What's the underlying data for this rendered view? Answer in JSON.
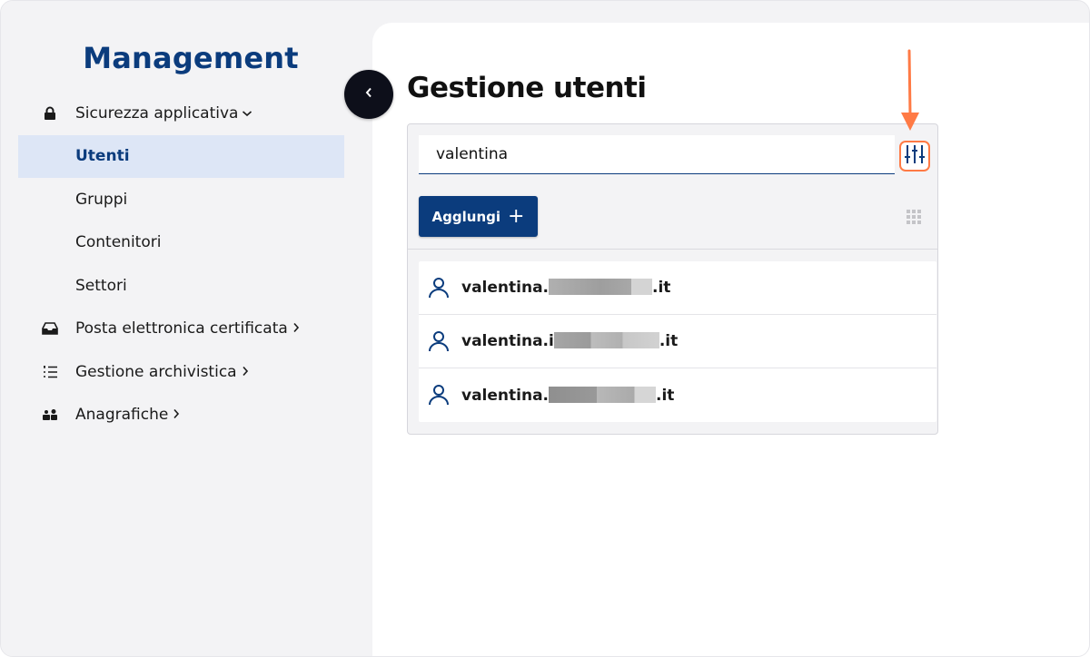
{
  "sidebar": {
    "brand": "Management",
    "items": [
      {
        "label": "Sicurezza applicativa",
        "icon": "lock-icon",
        "chevron": "down"
      },
      {
        "label": "Utenti",
        "active": true
      },
      {
        "label": "Gruppi"
      },
      {
        "label": "Contenitori"
      },
      {
        "label": "Settori"
      },
      {
        "label": "Posta elettronica certificata",
        "icon": "inbox-icon",
        "chevron": "right"
      },
      {
        "label": "Gestione archivistica",
        "icon": "list-icon",
        "chevron": "right"
      },
      {
        "label": "Anagrafiche",
        "icon": "people-icon",
        "chevron": "right"
      }
    ]
  },
  "main": {
    "title": "Gestione utenti",
    "search": {
      "value": "valentina"
    },
    "add_label": "Agglungi",
    "users": [
      {
        "prefix": "valentina.",
        "suffix": ".it"
      },
      {
        "prefix": "valentina.i",
        "suffix": ".it"
      },
      {
        "prefix": "valentina.",
        "suffix": ".it"
      }
    ]
  },
  "colors": {
    "brand": "#0b3c7d",
    "active_bg": "#dde6f6",
    "highlight": "#ff7a45",
    "sidebar_bg": "#f3f3f5"
  }
}
